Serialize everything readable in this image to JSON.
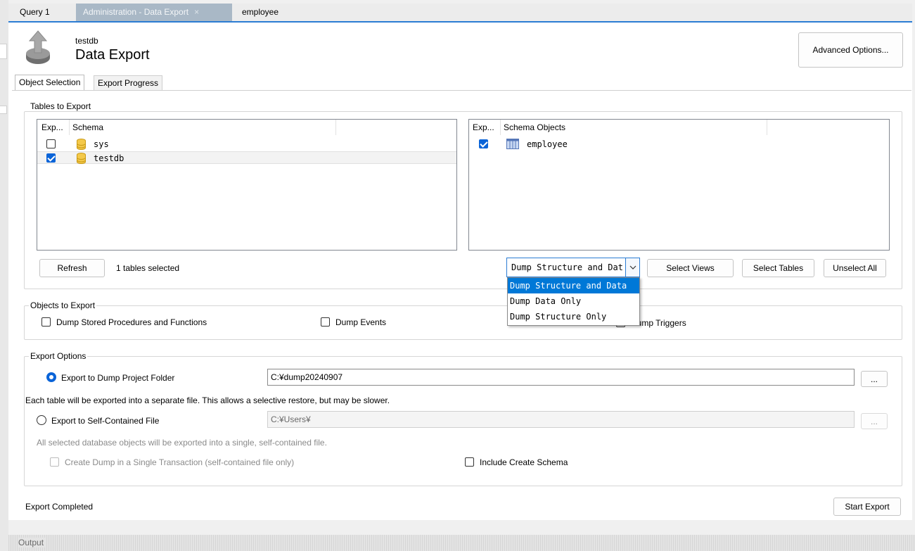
{
  "tabs": [
    {
      "label": "Query 1"
    },
    {
      "label": "Administration - Data Export",
      "close": "×"
    },
    {
      "label": "employee"
    }
  ],
  "header": {
    "db_name": "testdb",
    "title": "Data Export",
    "advanced_label": "Advanced Options..."
  },
  "page_tabs": [
    {
      "label": "Object Selection"
    },
    {
      "label": "Export Progress"
    }
  ],
  "tables_section": {
    "label": "Tables to Export",
    "schema_cols": [
      "Exp...",
      "Schema"
    ],
    "schemas": [
      {
        "name": "sys",
        "checked": false
      },
      {
        "name": "testdb",
        "checked": true
      }
    ],
    "object_cols": [
      "Exp...",
      "Schema Objects"
    ],
    "objects": [
      {
        "name": "employee",
        "checked": true
      }
    ],
    "refresh_label": "Refresh",
    "selected_count": "1 tables selected",
    "dump_value": "Dump Structure and Dat",
    "dump_options": [
      "Dump Structure and Data",
      "Dump Data Only",
      "Dump Structure Only"
    ],
    "select_views_label": "Select Views",
    "select_tables_label": "Select Tables",
    "unselect_all_label": "Unselect All"
  },
  "objects_section": {
    "label": "Objects to Export",
    "stored_procs": "Dump Stored Procedures and Functions",
    "events": "Dump Events",
    "triggers": "Dump Triggers"
  },
  "export_section": {
    "label": "Export Options",
    "folder_label": "Export to Dump Project Folder",
    "folder_path": "C:¥dump20240907",
    "folder_note": "Each table will be exported into a separate file. This allows a selective restore, but may be slower.",
    "file_label": "Export to Self-Contained File",
    "file_path": "C:¥Users¥",
    "file_note": "All selected database objects will be exported into a single, self-contained file.",
    "single_tx": "Create Dump in a Single Transaction (self-contained file only)",
    "include_schema": "Include Create Schema",
    "browse": "..."
  },
  "status": {
    "text": "Export Completed",
    "start_label": "Start Export"
  },
  "output": {
    "label": "Output"
  }
}
